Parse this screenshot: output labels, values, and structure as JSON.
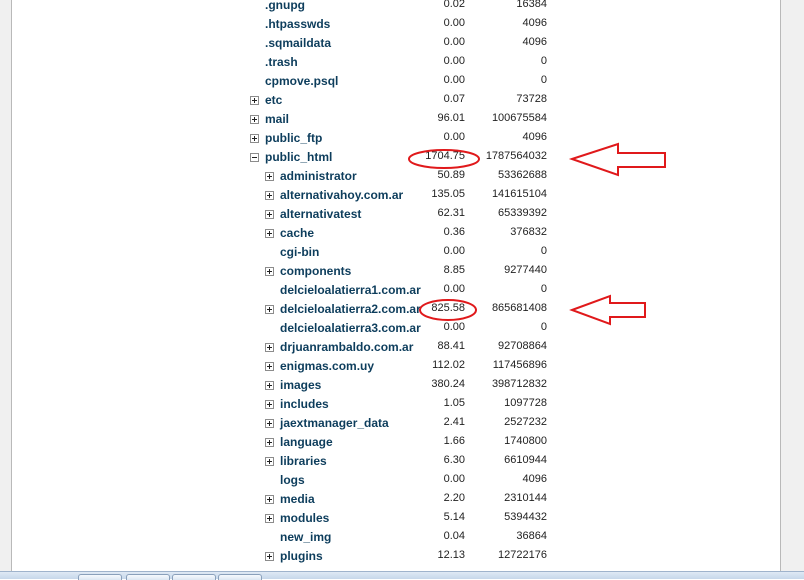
{
  "rows": [
    {
      "name": ".gnupg",
      "mb": "0.02",
      "bytes": "16384",
      "level": 0,
      "expander": "none"
    },
    {
      "name": ".htpasswds",
      "mb": "0.00",
      "bytes": "4096",
      "level": 0,
      "expander": "none"
    },
    {
      "name": ".sqmaildata",
      "mb": "0.00",
      "bytes": "4096",
      "level": 0,
      "expander": "none"
    },
    {
      "name": ".trash",
      "mb": "0.00",
      "bytes": "0",
      "level": 0,
      "expander": "none"
    },
    {
      "name": "cpmove.psql",
      "mb": "0.00",
      "bytes": "0",
      "level": 0,
      "expander": "none"
    },
    {
      "name": "etc",
      "mb": "0.07",
      "bytes": "73728",
      "level": 0,
      "expander": "plus"
    },
    {
      "name": "mail",
      "mb": "96.01",
      "bytes": "100675584",
      "level": 0,
      "expander": "plus"
    },
    {
      "name": "public_ftp",
      "mb": "0.00",
      "bytes": "4096",
      "level": 0,
      "expander": "plus"
    },
    {
      "name": "public_html",
      "mb": "1704.75",
      "bytes": "1787564032",
      "level": 0,
      "expander": "minus"
    },
    {
      "name": "administrator",
      "mb": "50.89",
      "bytes": "53362688",
      "level": 1,
      "expander": "plus"
    },
    {
      "name": "alternativahoy.com.ar",
      "mb": "135.05",
      "bytes": "141615104",
      "level": 1,
      "expander": "plus"
    },
    {
      "name": "alternativatest",
      "mb": "62.31",
      "bytes": "65339392",
      "level": 1,
      "expander": "plus"
    },
    {
      "name": "cache",
      "mb": "0.36",
      "bytes": "376832",
      "level": 1,
      "expander": "plus"
    },
    {
      "name": "cgi-bin",
      "mb": "0.00",
      "bytes": "0",
      "level": 1,
      "expander": "none"
    },
    {
      "name": "components",
      "mb": "8.85",
      "bytes": "9277440",
      "level": 1,
      "expander": "plus"
    },
    {
      "name": "delcieloalatierra1.com.ar",
      "mb": "0.00",
      "bytes": "0",
      "level": 1,
      "expander": "none"
    },
    {
      "name": "delcieloalatierra2.com.ar",
      "mb": "825.58",
      "bytes": "865681408",
      "level": 1,
      "expander": "plus"
    },
    {
      "name": "delcieloalatierra3.com.ar",
      "mb": "0.00",
      "bytes": "0",
      "level": 1,
      "expander": "none"
    },
    {
      "name": "drjuanrambaldo.com.ar",
      "mb": "88.41",
      "bytes": "92708864",
      "level": 1,
      "expander": "plus"
    },
    {
      "name": "enigmas.com.uy",
      "mb": "112.02",
      "bytes": "117456896",
      "level": 1,
      "expander": "plus"
    },
    {
      "name": "images",
      "mb": "380.24",
      "bytes": "398712832",
      "level": 1,
      "expander": "plus"
    },
    {
      "name": "includes",
      "mb": "1.05",
      "bytes": "1097728",
      "level": 1,
      "expander": "plus"
    },
    {
      "name": "jaextmanager_data",
      "mb": "2.41",
      "bytes": "2527232",
      "level": 1,
      "expander": "plus"
    },
    {
      "name": "language",
      "mb": "1.66",
      "bytes": "1740800",
      "level": 1,
      "expander": "plus"
    },
    {
      "name": "libraries",
      "mb": "6.30",
      "bytes": "6610944",
      "level": 1,
      "expander": "plus"
    },
    {
      "name": "logs",
      "mb": "0.00",
      "bytes": "4096",
      "level": 1,
      "expander": "none"
    },
    {
      "name": "media",
      "mb": "2.20",
      "bytes": "2310144",
      "level": 1,
      "expander": "plus"
    },
    {
      "name": "modules",
      "mb": "5.14",
      "bytes": "5394432",
      "level": 1,
      "expander": "plus"
    },
    {
      "name": "new_img",
      "mb": "0.04",
      "bytes": "36864",
      "level": 1,
      "expander": "none"
    },
    {
      "name": "plugins",
      "mb": "12.13",
      "bytes": "12722176",
      "level": 1,
      "expander": "plus"
    }
  ],
  "annotations": {
    "color": "#e0191b",
    "circled_rows": [
      "public_html",
      "delcieloalatierra2.com.ar"
    ],
    "arrow_rows": [
      "public_html",
      "delcieloalatierra2.com.ar"
    ]
  }
}
